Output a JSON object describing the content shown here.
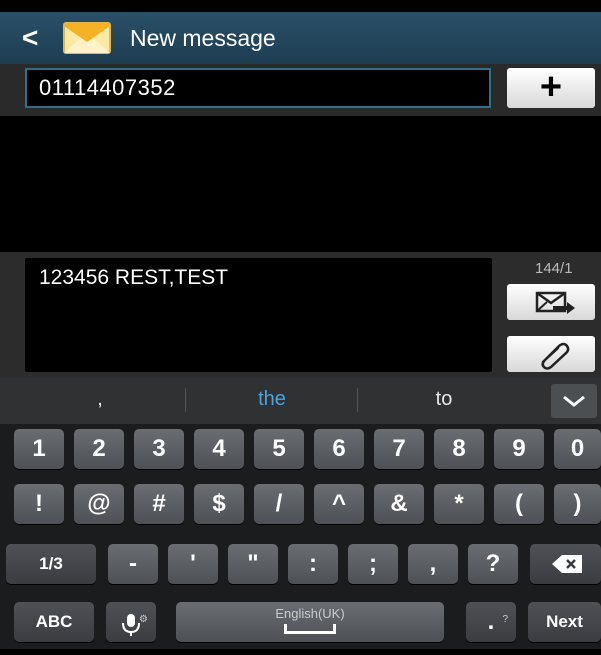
{
  "header": {
    "title": "New message"
  },
  "recipient": {
    "value": "01114407352",
    "add_label": "+"
  },
  "composer": {
    "text": "123456 REST,TEST",
    "counter": "144/1"
  },
  "suggestions": [
    ",",
    "the",
    "to"
  ],
  "keyboard": {
    "row1": [
      "1",
      "2",
      "3",
      "4",
      "5",
      "6",
      "7",
      "8",
      "9",
      "0"
    ],
    "row2": [
      "!",
      "@",
      "#",
      "$",
      "/",
      "^",
      "&",
      "*",
      "(",
      ")"
    ],
    "row3": [
      "1/3",
      "-",
      "'",
      "\"",
      ":",
      ";",
      ",",
      "?"
    ],
    "row4": {
      "abc": "ABC",
      "language": "English(UK)",
      "period": ".",
      "next": "Next"
    }
  },
  "colors": {
    "header": "#24475c",
    "suggestion_highlight": "#4aa3df",
    "keyboard_bg": "#1b1c1e",
    "key": "#5c5f63"
  },
  "icons": {
    "back": "chevron-left-icon",
    "app": "envelope-icon",
    "send": "send-icon",
    "attach": "paperclip-icon",
    "collapse": "chevron-down-icon",
    "mic": "microphone-icon",
    "backspace": "backspace-icon"
  }
}
